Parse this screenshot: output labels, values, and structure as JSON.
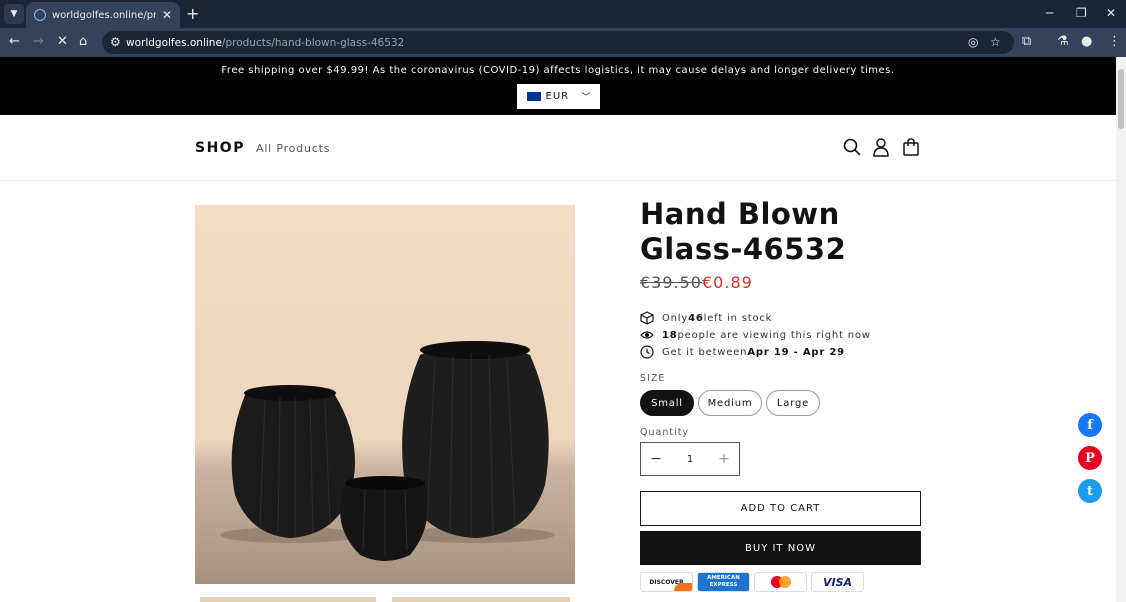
{
  "browser": {
    "tab_title": "worldgolfes.online/products/ha",
    "url_host": "worldgolfes.online",
    "url_path": "/products/hand-blown-glass-46532"
  },
  "announcement": {
    "message": "Free shipping over $49.99! As the coronavirus (COVID-19) affects logistics, it may cause delays and longer delivery times.",
    "currency": "EUR"
  },
  "header": {
    "logo": "SHOP",
    "nav_all_products": "All Products"
  },
  "product": {
    "title": "Hand Blown Glass-46532",
    "price_old": "€39.50",
    "price_new": "€0.89",
    "stock_prefix": "Only ",
    "stock_count": "46",
    "stock_suffix": " left in stock",
    "viewers_count": "18",
    "viewers_suffix": " people are viewing this right now",
    "delivery_prefix": "Get it between ",
    "delivery_range": "Apr 19 - Apr 29",
    "size_label": "SIZE",
    "sizes": [
      "Small",
      "Medium",
      "Large"
    ],
    "selected_size": "Small",
    "quantity_label": "Quantity",
    "quantity": "1",
    "add_to_cart": "ADD TO CART",
    "buy_now": "BUY IT NOW"
  },
  "payments": {
    "discover": "DISCOVER",
    "amex": "AMERICAN EXPRESS",
    "visa": "VISA"
  },
  "social": {
    "facebook": "f",
    "pinterest": "P",
    "twitter": "t"
  },
  "colors": {
    "sale_price": "#d32f2f",
    "announcement_bg": "#000000",
    "facebook": "#1877f2",
    "pinterest": "#e60023",
    "twitter": "#1d9bf0"
  }
}
